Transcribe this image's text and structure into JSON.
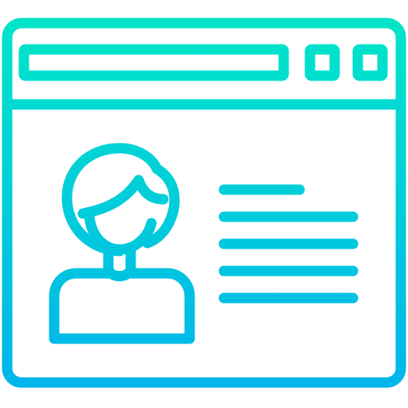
{
  "icon": {
    "name": "user-profile-browser-window-icon",
    "style": "outline",
    "colors": {
      "gradient_top": "#00E5C8",
      "gradient_bottom": "#00B4EC",
      "background": "#FFFFFF"
    },
    "parts": {
      "window": "browser-window-icon",
      "address_bar": "address-bar-icon",
      "window_buttons": [
        "window-button-icon",
        "window-button-icon"
      ],
      "avatar": "user-avatar-icon",
      "text_lines_count": 5
    }
  }
}
